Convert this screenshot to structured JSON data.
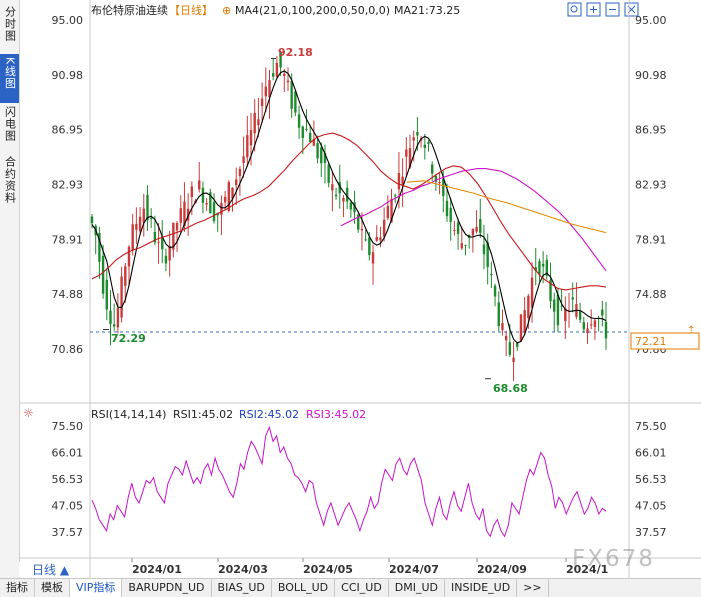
{
  "left_tabs": [
    {
      "label": "分时图",
      "active": false
    },
    {
      "label": "K线图",
      "active": true
    },
    {
      "label": "闪电图",
      "active": false
    },
    {
      "label": "合约资料",
      "active": false
    }
  ],
  "header": {
    "symbol": "布伦特原油连续",
    "period_tag": "【日线】",
    "ma4_text": "MA4(21,0,100,200,0,50,0,0)",
    "ma21_text": "MA21:73.25"
  },
  "toolbar_icons": [
    "search-icon",
    "zoom-in-icon",
    "zoom-out-icon",
    "close-icon"
  ],
  "price_axis": {
    "left_ticks": [
      "95.00",
      "90.98",
      "86.95",
      "82.93",
      "78.91",
      "74.88",
      "70.86"
    ],
    "right_ticks": [
      "95.00",
      "90.98",
      "86.95",
      "82.93",
      "78.91",
      "74.88",
      "70.86"
    ],
    "current_price": "72.21",
    "high_label": "92.18",
    "low_label_1": "72.29",
    "low_label_2": "68.68"
  },
  "rsi": {
    "title": "RSI(14,14,14)",
    "rsi1": "RSI1:45.02",
    "rsi2": "RSI2:45.02",
    "rsi3": "RSI3:45.02",
    "ticks": [
      "75.50",
      "66.01",
      "56.53",
      "47.05",
      "37.57"
    ]
  },
  "date_axis": [
    "2024/01",
    "2024/03",
    "2024/05",
    "2024/07",
    "2024/09",
    "2024/1"
  ],
  "period_button": "日线 ▲",
  "bottom_tabs": [
    "指标",
    "模板",
    "VIP指标",
    "BARUPDN_UD",
    "BIAS_UD",
    "BOLL_UD",
    "CCI_UD",
    "DMI_UD",
    "INSIDE_UD",
    ">>"
  ],
  "active_bottom_tab": "VIP指标",
  "watermark": "FX678",
  "colors": {
    "up": "#c93b3b",
    "down": "#1e8a2e",
    "ma_short": "#000000",
    "ma_mid": "#c61a1a",
    "ma_long": "#d012c8",
    "ma_longest": "#e08a00",
    "rsi_line": "#c514c9",
    "accent": "#2b63c5"
  },
  "chart_data": [
    {
      "type": "candlestick",
      "title": "布伦特原油连续【日线】",
      "price_range": [
        68.0,
        95.0
      ],
      "x_labels": [
        "2024/01",
        "2024/03",
        "2024/05",
        "2024/07",
        "2024/09",
        "2024/1"
      ],
      "close": [
        80.0,
        79.2,
        77.4,
        75.6,
        74.3,
        73.4,
        72.6,
        73.8,
        75.4,
        77.2,
        78.6,
        79.4,
        80.2,
        81.0,
        81.3,
        80.6,
        79.9,
        79.1,
        78.3,
        77.6,
        77.9,
        78.6,
        79.4,
        80.2,
        80.6,
        81.2,
        81.7,
        82.2,
        82.5,
        82.7,
        82.3,
        81.8,
        81.4,
        80.9,
        80.8,
        81.2,
        81.8,
        82.5,
        83.0,
        83.5,
        84.2,
        85.0,
        85.8,
        86.6,
        87.4,
        88.4,
        89.4,
        90.2,
        90.8,
        91.4,
        91.8,
        91.5,
        90.8,
        89.9,
        89.0,
        88.1,
        87.5,
        87.1,
        86.9,
        86.5,
        85.9,
        85.2,
        84.5,
        83.8,
        83.2,
        82.6,
        82.3,
        82.1,
        81.8,
        81.5,
        81.0,
        80.5,
        79.8,
        79.0,
        78.3,
        78.0,
        78.2,
        78.9,
        79.6,
        80.3,
        81.1,
        81.9,
        82.7,
        83.5,
        84.3,
        85.1,
        85.9,
        86.6,
        87.1,
        86.7,
        86.0,
        85.2,
        84.3,
        83.4,
        82.6,
        81.8,
        81.0,
        80.3,
        79.6,
        79.0,
        78.7,
        78.8,
        79.3,
        79.6,
        79.5,
        78.9,
        78.0,
        77.0,
        75.8,
        74.5,
        73.2,
        72.0,
        71.1,
        70.6,
        71.0,
        71.8,
        72.6,
        73.6,
        74.8,
        76.0,
        76.9,
        77.1,
        76.5,
        75.6,
        74.7,
        74.0,
        73.4,
        73.2,
        73.5,
        74.0,
        74.1,
        73.7,
        73.1,
        72.7,
        72.9,
        73.3,
        73.5,
        73.1,
        72.6,
        72.21
      ],
      "ma_short": [
        80.0,
        79.2,
        77.4,
        75.6,
        74.3,
        73.4,
        72.6,
        73.8,
        75.4,
        77.2,
        78.6,
        79.4,
        80.2,
        81.0,
        81.3,
        80.6,
        79.9,
        79.1,
        78.3,
        77.6,
        77.9,
        78.6,
        79.4,
        80.2,
        80.6,
        81.2,
        81.7,
        82.2,
        82.5,
        82.7,
        82.3,
        81.8,
        81.4,
        80.9,
        80.8,
        81.2,
        81.8,
        82.5,
        83.0,
        83.5,
        84.2,
        85.0,
        85.8,
        86.6,
        87.4,
        88.4,
        89.4,
        90.2,
        90.8,
        91.4,
        91.8,
        91.5,
        90.8,
        89.9,
        89.0,
        88.1,
        87.5,
        87.1,
        86.9,
        86.5,
        85.9,
        85.2,
        84.5,
        83.8,
        83.2,
        82.6,
        82.3,
        82.1,
        81.8,
        81.5,
        81.0,
        80.5,
        79.8,
        79.0,
        78.3,
        78.0,
        78.2,
        78.9,
        79.6,
        80.3,
        81.1,
        81.9,
        82.7,
        83.5,
        84.3,
        85.1,
        85.9,
        86.6,
        87.1,
        86.7,
        86.0,
        85.2,
        84.3,
        83.4,
        82.6,
        81.8,
        81.0,
        80.3,
        79.6,
        79.0,
        78.7,
        78.8,
        79.3,
        79.6,
        79.5,
        78.9,
        78.0,
        77.0,
        75.8,
        74.5,
        73.2,
        72.0,
        71.1,
        70.6,
        71.0,
        71.8,
        72.6,
        73.6,
        74.8,
        76.0,
        76.9,
        77.1,
        76.5,
        75.6,
        74.7,
        74.0,
        73.4,
        73.2,
        73.5,
        74.0,
        74.1,
        73.7,
        73.1,
        72.7,
        72.9,
        73.3,
        73.5,
        73.1,
        72.6,
        72.21
      ],
      "ma_mid": [
        76.0,
        76.3,
        76.8,
        77.4,
        77.8,
        78.1,
        78.3,
        78.6,
        78.9,
        79.1,
        79.3,
        79.5,
        79.8,
        80.1,
        80.3,
        80.6,
        80.9,
        81.2,
        81.6,
        81.9,
        82.1,
        82.4,
        82.8,
        83.4,
        84.0,
        84.7,
        85.3,
        85.9,
        86.4,
        86.6,
        86.7,
        86.5,
        86.2,
        85.8,
        85.2,
        84.6,
        83.9,
        83.4,
        83.0,
        82.8,
        82.6,
        82.9,
        83.3,
        83.7,
        84.1,
        84.3,
        84.2,
        83.7,
        83.0,
        82.1,
        81.1,
        80.1,
        79.2,
        78.4,
        77.6,
        76.8,
        76.1,
        75.7,
        75.3,
        75.2,
        75.3,
        75.4,
        75.5,
        75.5,
        75.4
      ],
      "ma_long": [
        79.9,
        80.2,
        80.5,
        80.7,
        81.0,
        81.3,
        81.7,
        82.0,
        82.3,
        82.5,
        82.8,
        83.0,
        83.3,
        83.5,
        83.7,
        83.9,
        84.0,
        84.1,
        84.1,
        84.0,
        83.9,
        83.6,
        83.3,
        82.9,
        82.5,
        82.0,
        81.5,
        81.0,
        80.4,
        79.7,
        79.0,
        78.2,
        77.4,
        76.6
      ],
      "ma_longest": [
        83.1,
        83.2,
        82.9,
        82.6,
        82.3,
        81.9,
        81.6,
        81.2,
        80.8,
        80.4,
        80.0,
        79.7,
        79.4
      ],
      "high": 92.18,
      "low": 68.68
    },
    {
      "type": "line",
      "title": "RSI(14,14,14)",
      "series": [
        {
          "name": "RSI1",
          "values": [
            49,
            46,
            42,
            40,
            38,
            44,
            42,
            47,
            45,
            43,
            50,
            55,
            50,
            48,
            52,
            56,
            55,
            57,
            52,
            50,
            48,
            55,
            58,
            61,
            60,
            58,
            63,
            59,
            55,
            57,
            55,
            60,
            62,
            58,
            64,
            60,
            58,
            55,
            52,
            50,
            55,
            62,
            60,
            66,
            70,
            68,
            65,
            62,
            72,
            75,
            70,
            72,
            66,
            68,
            64,
            62,
            58,
            57,
            55,
            52,
            56,
            55,
            48,
            44,
            40,
            45,
            48,
            44,
            40,
            43,
            46,
            48,
            45,
            42,
            38,
            42,
            45,
            50,
            46,
            48,
            55,
            60,
            58,
            56,
            62,
            64,
            60,
            58,
            62,
            64,
            60,
            56,
            48,
            44,
            40,
            46,
            50,
            44,
            42,
            48,
            52,
            47,
            45,
            50,
            55,
            48,
            44,
            42,
            46,
            38,
            36,
            40,
            42,
            38,
            36,
            40,
            48,
            46,
            44,
            50,
            56,
            60,
            58,
            62,
            66,
            64,
            58,
            54,
            46,
            50,
            48,
            44,
            47,
            50,
            52,
            48,
            44,
            46,
            50,
            48,
            44,
            46,
            45.02
          ]
        }
      ],
      "ylim": [
        33.5,
        76.0
      ],
      "ticks": [
        75.5,
        66.01,
        56.53,
        47.05,
        37.57
      ]
    }
  ]
}
